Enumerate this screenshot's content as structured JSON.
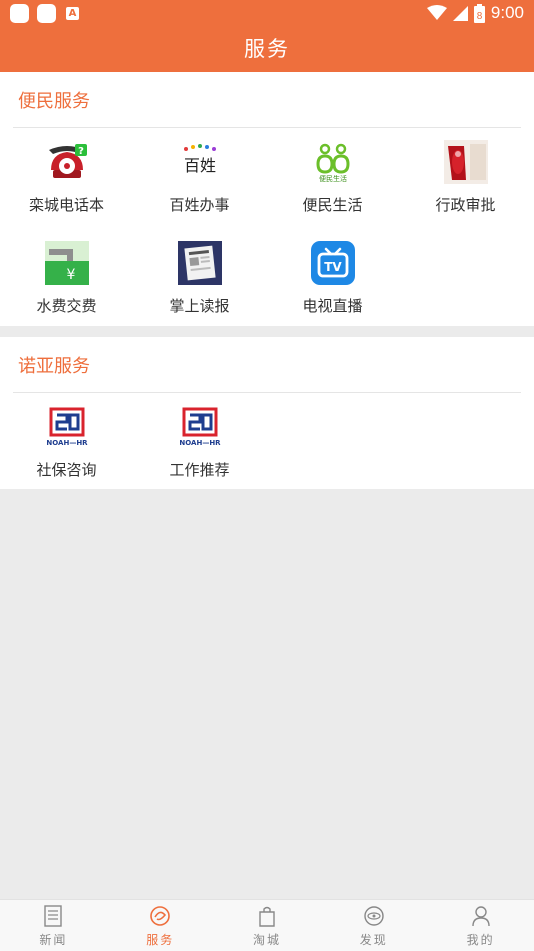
{
  "status_bar": {
    "time": "9:00",
    "battery": "8"
  },
  "header": {
    "title": "服务"
  },
  "sections": [
    {
      "title": "便民服务",
      "items": [
        {
          "label": "栾城电话本",
          "icon": "phone-book-icon"
        },
        {
          "label": "百姓办事",
          "icon": "baixing-icon",
          "icon_text": "百姓"
        },
        {
          "label": "便民生活",
          "icon": "bianmin-life-icon",
          "icon_text": "便民生活"
        },
        {
          "label": "行政审批",
          "icon": "approval-stamp-icon"
        },
        {
          "label": "水费交费",
          "icon": "water-fee-icon"
        },
        {
          "label": "掌上读报",
          "icon": "newspaper-icon"
        },
        {
          "label": "电视直播",
          "icon": "tv-live-icon"
        }
      ]
    },
    {
      "title": "诺亚服务",
      "items": [
        {
          "label": "社保咨询",
          "icon": "noah-hr-logo-icon",
          "icon_text": "NOAH—HR"
        },
        {
          "label": "工作推荐",
          "icon": "noah-hr-logo-icon",
          "icon_text": "NOAH—HR"
        }
      ]
    }
  ],
  "tab_bar": {
    "tabs": [
      {
        "label": "新闻",
        "icon": "news-icon",
        "active": false
      },
      {
        "label": "服务",
        "icon": "service-icon",
        "active": true
      },
      {
        "label": "淘城",
        "icon": "shopping-bag-icon",
        "active": false
      },
      {
        "label": "发现",
        "icon": "discover-icon",
        "active": false
      },
      {
        "label": "我的",
        "icon": "profile-icon",
        "active": false
      }
    ]
  },
  "colors": {
    "accent": "#ee6f3d",
    "background": "#ebebeb"
  }
}
